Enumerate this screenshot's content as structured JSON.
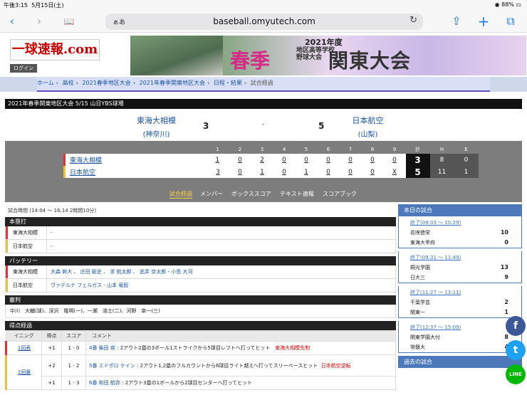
{
  "status": {
    "time": "午後3:15",
    "date": "5月15日(土)",
    "battery": "88%"
  },
  "browser": {
    "aa": "ぁあ",
    "url": "baseball.omyutech.com",
    "reload": "↻",
    "back": "‹",
    "fwd": "›",
    "book": "📖",
    "share": "⇪",
    "plus": "+",
    "tabs": "⧉"
  },
  "site": {
    "logo": "一球速報.com",
    "login": "ログイン"
  },
  "banner": {
    "year": "2021年度",
    "spring": "春季",
    "sub1": "地区高等学校",
    "sub2": "野球大会",
    "big": "関東大会"
  },
  "breadcrumb": [
    "ホーム",
    "高校",
    "2021春季地区大会",
    "2021年春季関東地区大会",
    "日程・結果",
    "試合経過"
  ],
  "game": {
    "info": "2021年春季関東地区大会 5/15 山日YBS球場",
    "home": {
      "name": "東海大相模",
      "pref": "(神奈川)",
      "runs": "3"
    },
    "away": {
      "name": "日本航空",
      "pref": "(山梨)",
      "runs": "5"
    },
    "dash": "-"
  },
  "linescore": {
    "headers": [
      "1",
      "2",
      "3",
      "4",
      "5",
      "6",
      "7",
      "8",
      "9",
      "計",
      "H",
      "E"
    ],
    "rows": [
      {
        "team": "東海大相模",
        "innings": [
          "1",
          "0",
          "2",
          "0",
          "0",
          "0",
          "0",
          "0",
          "0"
        ],
        "total": "3",
        "h": "8",
        "e": "0"
      },
      {
        "team": "日本航空",
        "innings": [
          "3",
          "0",
          "1",
          "0",
          "1",
          "0",
          "0",
          "0",
          "X"
        ],
        "total": "5",
        "h": "11",
        "e": "1"
      }
    ]
  },
  "tabs": [
    "試合経過",
    "メンバー",
    "ボックススコア",
    "テキスト速報",
    "スコアブック"
  ],
  "time_line": "試合時間 (14:04 〜 16:14 2時間10分)",
  "homerun": {
    "title": "本塁打",
    "rows": [
      {
        "team": "東海大相模",
        "value": "-"
      },
      {
        "team": "日本航空",
        "value": "-"
      }
    ]
  },
  "battery": {
    "title": "バッテリー",
    "rows": [
      {
        "team": "東海大相模",
        "pitchers": "大森 幹大 、 庄田 聡史 、 求 航太郎 、 武井 京太郎",
        "dash": " - ",
        "catcher": "小島 大河"
      },
      {
        "team": "日本航空",
        "pitchers": "ヴァデルナ フェルガス",
        "dash": " - ",
        "catcher": "山本 竜毅"
      }
    ]
  },
  "umpire": {
    "title": "審判",
    "text": "中川　大輔(球)、深沢　隆明(一)、一瀬　浩士(二)、河野　幸一(三)"
  },
  "scoring": {
    "title": "得点経過",
    "headers": [
      "イニング",
      "得点",
      "スコア",
      "コメント"
    ],
    "rows": [
      {
        "inning": "1回表",
        "pts": "+1",
        "score": "1 - 0",
        "batter": "4番 柴田 疾",
        "desc": " : 2アウト2塁の3ボール1ストライクから5球目レフトへ打ってヒット",
        "note": "東海大相模先制"
      },
      {
        "inning": "1回裏",
        "pts": "+2",
        "score": "1 - 2",
        "batter": "5番 エドポロ ケイン",
        "desc": " : 2アウト1,2塁のフルカウントから6球目ライト越えへ打ってスリーベースヒット",
        "note": "日本航空逆転"
      },
      {
        "inning": "",
        "pts": "+1",
        "score": "1 - 3",
        "batter": "6番 和田 航弥",
        "desc": " : 2アウト3塁の1ボールから2球目センターへ打ってヒット",
        "note": ""
      }
    ]
  },
  "today": {
    "title": "本日の試合",
    "games": [
      {
        "status": "終了(09:03 〜 10:29)",
        "t1": "花咲徳栄",
        "s1": "10",
        "t2": "東海大甲府",
        "s2": "0"
      },
      {
        "status": "終了(09:31 〜 11:49)",
        "t1": "桐光学園",
        "s1": "13",
        "t2": "日大三",
        "s2": "9"
      },
      {
        "status": "終了(11:27 〜 13:11)",
        "t1": "千葉学芸",
        "s1": "2",
        "t2": "関東一",
        "s2": "1"
      },
      {
        "status": "終了(12:37 〜 15:09)",
        "t1": "関東学園大付",
        "s1": "8",
        "t2": "常磐大",
        "s2": "4"
      }
    ],
    "past": "過去の試合"
  },
  "share": {
    "fb": "f",
    "tw": "t",
    "line": "LINE"
  },
  "colors": {
    "accent": "#4d79bb",
    "link": "#1a55a8",
    "fb": "#3b5998",
    "tw": "#1da1f2",
    "line": "#00b900"
  }
}
